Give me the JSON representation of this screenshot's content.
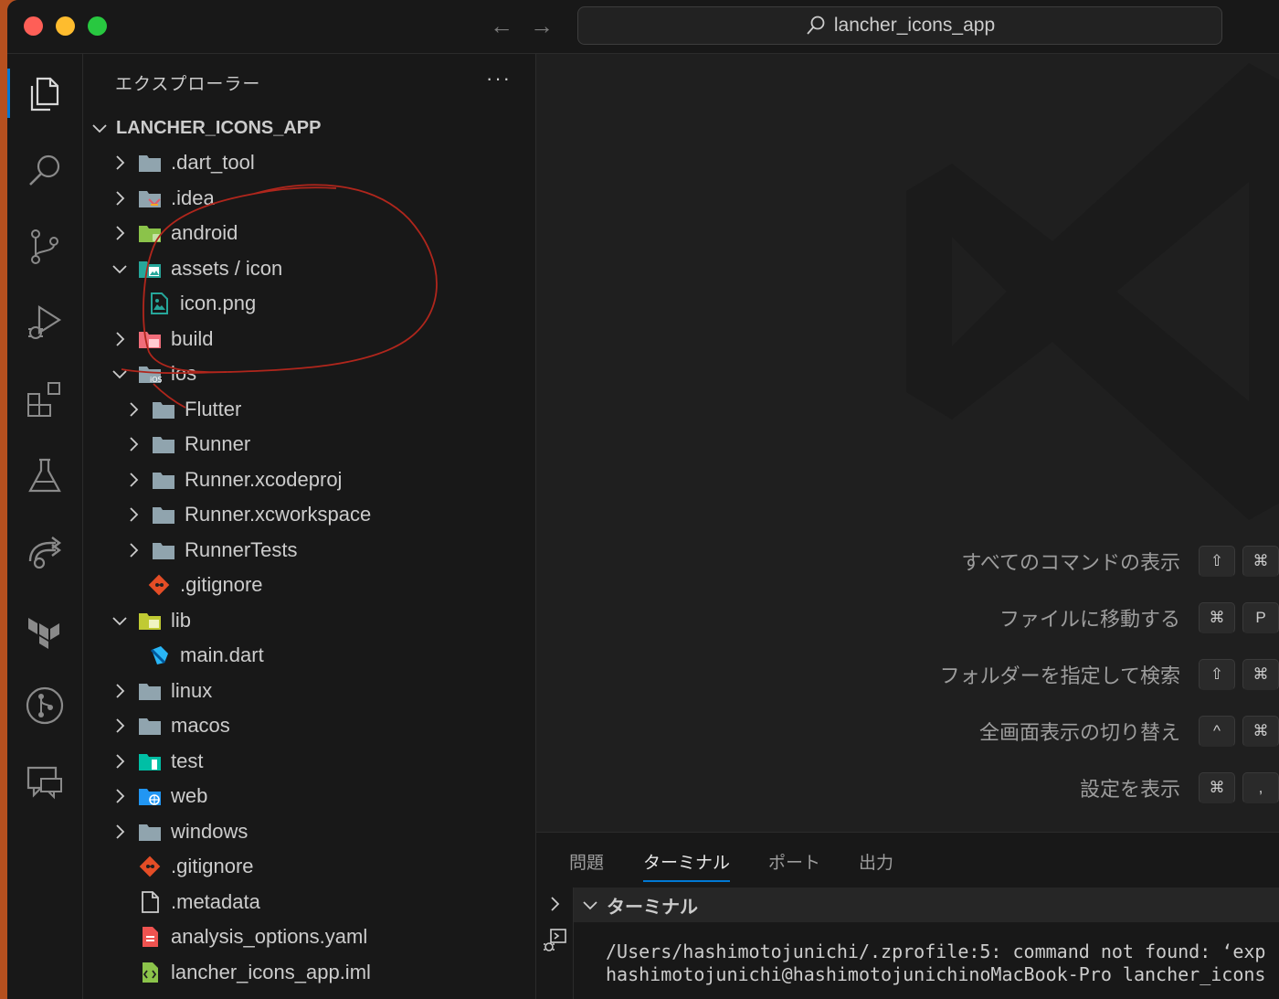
{
  "titlebar": {
    "search_text": "lancher_icons_app"
  },
  "activity_bar": [
    {
      "name": "explorer-icon"
    },
    {
      "name": "search-icon"
    },
    {
      "name": "source-control-icon"
    },
    {
      "name": "run-debug-icon"
    },
    {
      "name": "extensions-icon"
    },
    {
      "name": "testing-icon"
    },
    {
      "name": "remote-explorer-icon"
    },
    {
      "name": "terraform-icon"
    },
    {
      "name": "git-graph-icon"
    },
    {
      "name": "chat-icon"
    }
  ],
  "sidebar": {
    "title": "エクスプローラー",
    "root": "LANCHER_ICONS_APP",
    "tree": [
      {
        "label": ".dart_tool",
        "indent": 0,
        "chevron": "right",
        "icon": "folder"
      },
      {
        "label": ".idea",
        "indent": 0,
        "chevron": "right",
        "icon": "folder-idea"
      },
      {
        "label": "android",
        "indent": 0,
        "chevron": "right",
        "icon": "folder-android"
      },
      {
        "label": "assets / icon",
        "indent": 0,
        "chevron": "down",
        "icon": "folder-images"
      },
      {
        "label": "icon.png",
        "indent": 1,
        "chevron": "none",
        "icon": "file-image"
      },
      {
        "label": "build",
        "indent": 0,
        "chevron": "right",
        "icon": "folder-build"
      },
      {
        "label": "ios",
        "indent": 0,
        "chevron": "down",
        "icon": "folder-ios"
      },
      {
        "label": "Flutter",
        "indent": 1,
        "chevron": "right",
        "icon": "folder"
      },
      {
        "label": "Runner",
        "indent": 1,
        "chevron": "right",
        "icon": "folder"
      },
      {
        "label": "Runner.xcodeproj",
        "indent": 1,
        "chevron": "right",
        "icon": "folder"
      },
      {
        "label": "Runner.xcworkspace",
        "indent": 1,
        "chevron": "right",
        "icon": "folder"
      },
      {
        "label": "RunnerTests",
        "indent": 1,
        "chevron": "right",
        "icon": "folder"
      },
      {
        "label": ".gitignore",
        "indent": 1,
        "chevron": "none",
        "icon": "file-git"
      },
      {
        "label": "lib",
        "indent": 0,
        "chevron": "down",
        "icon": "folder-lib"
      },
      {
        "label": "main.dart",
        "indent": 1,
        "chevron": "none",
        "icon": "file-dart"
      },
      {
        "label": "linux",
        "indent": 0,
        "chevron": "right",
        "icon": "folder"
      },
      {
        "label": "macos",
        "indent": 0,
        "chevron": "right",
        "icon": "folder"
      },
      {
        "label": "test",
        "indent": 0,
        "chevron": "right",
        "icon": "folder-test"
      },
      {
        "label": "web",
        "indent": 0,
        "chevron": "right",
        "icon": "folder-web"
      },
      {
        "label": "windows",
        "indent": 0,
        "chevron": "right",
        "icon": "folder"
      },
      {
        "label": ".gitignore",
        "indent": 0,
        "chevron": "none",
        "icon": "file-git"
      },
      {
        "label": ".metadata",
        "indent": 0,
        "chevron": "none",
        "icon": "file-generic"
      },
      {
        "label": "analysis_options.yaml",
        "indent": 0,
        "chevron": "none",
        "icon": "file-yaml"
      },
      {
        "label": "lancher_icons_app.iml",
        "indent": 0,
        "chevron": "none",
        "icon": "file-iml"
      }
    ]
  },
  "editor": {
    "shortcuts": [
      {
        "label": "すべてのコマンドの表示",
        "keys": [
          "⇧",
          "⌘"
        ]
      },
      {
        "label": "ファイルに移動する",
        "keys": [
          "⌘",
          "P"
        ]
      },
      {
        "label": "フォルダーを指定して検索",
        "keys": [
          "⇧",
          "⌘"
        ]
      },
      {
        "label": "全画面表示の切り替え",
        "keys": [
          "^",
          "⌘"
        ]
      },
      {
        "label": "設定を表示",
        "keys": [
          "⌘",
          ","
        ]
      }
    ]
  },
  "panel": {
    "tabs": [
      "問題",
      "ターミナル",
      "ポート",
      "出力"
    ],
    "active_tab": "ターミナル",
    "terminal_header": "ターミナル",
    "terminal_lines": [
      "/Users/hashimotojunichi/.zprofile:5: command not found: ‘exp",
      "hashimotojunichi@hashimotojunichinoMacBook-Pro lancher_icons"
    ]
  },
  "colors": {
    "accent": "#0078d4",
    "annotation": "#b0261c",
    "folder": "#90a4ae"
  }
}
